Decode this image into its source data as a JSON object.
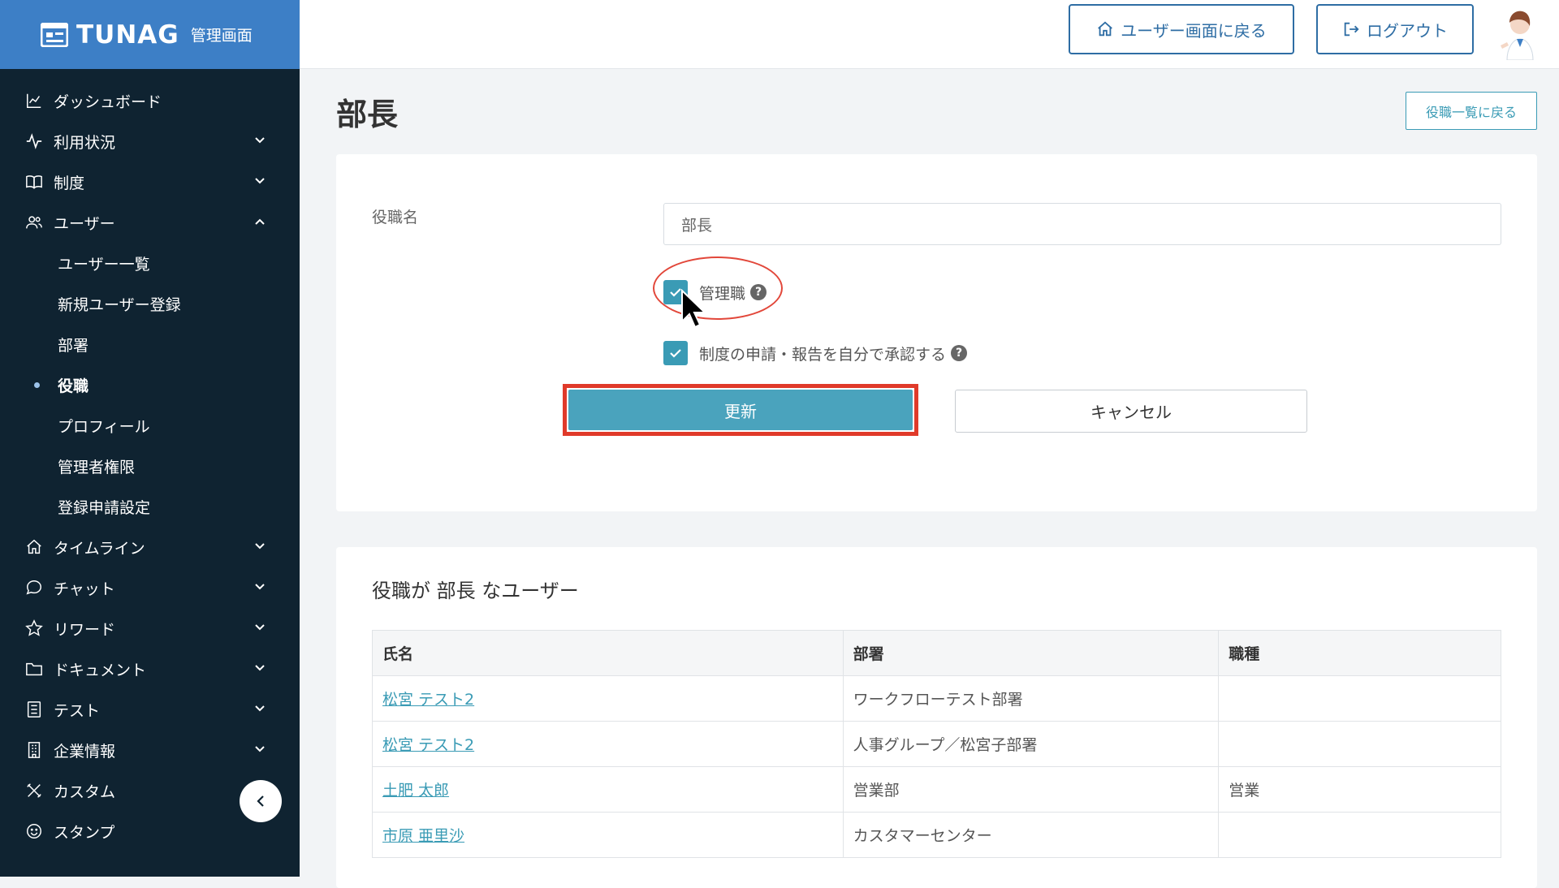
{
  "brand": {
    "name": "TUNAG",
    "subtitle": "管理画面"
  },
  "sidebar": {
    "items": [
      {
        "label": "ダッシュボード",
        "icon": "chart-line-icon",
        "chevron": "none"
      },
      {
        "label": "利用状況",
        "icon": "activity-icon",
        "chevron": "down"
      },
      {
        "label": "制度",
        "icon": "book-icon",
        "chevron": "down"
      },
      {
        "label": "ユーザー",
        "icon": "users-icon",
        "chevron": "up"
      },
      {
        "label": "タイムライン",
        "icon": "home-icon",
        "chevron": "down"
      },
      {
        "label": "チャット",
        "icon": "chat-bubble-icon",
        "chevron": "down"
      },
      {
        "label": "リワード",
        "icon": "star-icon",
        "chevron": "down"
      },
      {
        "label": "ドキュメント",
        "icon": "folder-icon",
        "chevron": "down"
      },
      {
        "label": "テスト",
        "icon": "checklist-icon",
        "chevron": "down"
      },
      {
        "label": "企業情報",
        "icon": "building-icon",
        "chevron": "down"
      },
      {
        "label": "カスタム",
        "icon": "tools-icon",
        "chevron": "none"
      },
      {
        "label": "スタンプ",
        "icon": "smile-icon",
        "chevron": "none"
      }
    ],
    "sub_items": [
      {
        "label": "ユーザー一覧",
        "active": false
      },
      {
        "label": "新規ユーザー登録",
        "active": false
      },
      {
        "label": "部署",
        "active": false
      },
      {
        "label": "役職",
        "active": true
      },
      {
        "label": "プロフィール",
        "active": false
      },
      {
        "label": "管理者権限",
        "active": false
      },
      {
        "label": "登録申請設定",
        "active": false
      }
    ]
  },
  "header": {
    "user_screen_label": "ユーザー画面に戻る",
    "logout_label": "ログアウト"
  },
  "page": {
    "title": "部長",
    "back_to_list_label": "役職一覧に戻る"
  },
  "form": {
    "name_label": "役職名",
    "name_value": "部長",
    "checkbox_manager_label": "管理職",
    "checkbox_manager_checked": true,
    "checkbox_self_approve_label": "制度の申請・報告を自分で承認する",
    "checkbox_self_approve_checked": true,
    "help_glyph": "?",
    "update_label": "更新",
    "cancel_label": "キャンセル"
  },
  "users_section": {
    "title": "役職が 部長 なユーザー",
    "columns": [
      "氏名",
      "部署",
      "職種"
    ],
    "rows": [
      [
        "松宮 テスト2",
        "ワークフローテスト部署",
        ""
      ],
      [
        "松宮 テスト2",
        "人事グループ／松宮子部署",
        ""
      ],
      [
        "土肥 太郎",
        "営業部",
        "営業"
      ],
      [
        "市原 亜里沙",
        "カスタマーセンター",
        ""
      ]
    ]
  },
  "colors": {
    "brand_blue": "#3d7fc6",
    "sidebar_bg": "#0f2331",
    "accent_teal": "#4aa3bd",
    "highlight_red": "#e03a2a"
  }
}
